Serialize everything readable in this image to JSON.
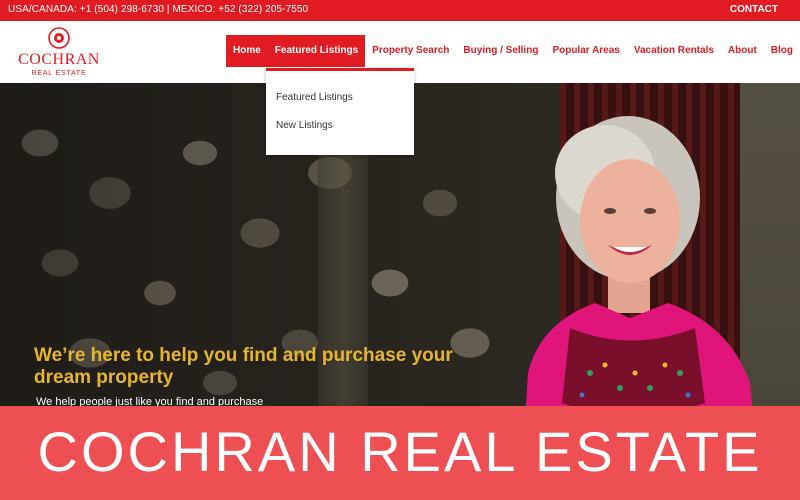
{
  "topbar": {
    "contacts": "USA/CANADA: +1 (504) 298-6730  |  MEXICO: +52 (322) 205-7550",
    "contact_link": "CONTACT"
  },
  "logo": {
    "brand": "COCHRAN",
    "sub": "REAL ESTATE"
  },
  "nav": {
    "items": [
      {
        "label": "Home"
      },
      {
        "label": "Featured Listings"
      },
      {
        "label": "Property Search"
      },
      {
        "label": "Buying / Selling"
      },
      {
        "label": "Popular Areas"
      },
      {
        "label": "Vacation Rentals"
      },
      {
        "label": "About"
      },
      {
        "label": "Blog"
      }
    ]
  },
  "dropdown": {
    "items": [
      {
        "label": "Featured Listings"
      },
      {
        "label": "New Listings"
      }
    ]
  },
  "hero": {
    "headline": "We’re here to help you find and purchase your dream property",
    "subline": "We help people just like you find and purchase"
  },
  "banner": {
    "title": "COCHRAN REAL ESTATE"
  },
  "colors": {
    "brand_red": "#e01b22",
    "banner_red": "#ee4f52",
    "headline_gold": "#e5b52e"
  }
}
